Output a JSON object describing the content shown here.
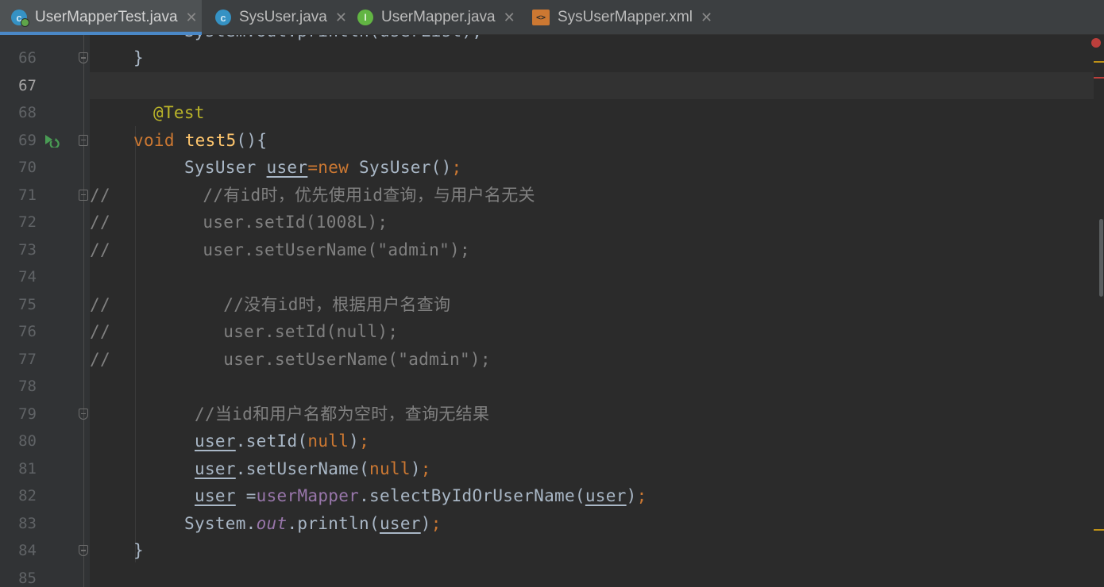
{
  "tabs": [
    {
      "label": "UserMapperTest.java",
      "icon": "test-class-icon",
      "active": true
    },
    {
      "label": "SysUser.java",
      "icon": "class-icon",
      "active": false
    },
    {
      "label": "UserMapper.java",
      "icon": "interface-icon",
      "active": false
    },
    {
      "label": "SysUserMapper.xml",
      "icon": "xml-file-icon",
      "active": false
    }
  ],
  "editor": {
    "current_line": "67",
    "partial_top_line": "System.out.println(userList);",
    "lines": [
      {
        "n": "66",
        "code": "}"
      },
      {
        "n": "67",
        "code": ""
      },
      {
        "n": "68",
        "code": "@Test"
      },
      {
        "n": "69",
        "code": "void test5(){"
      },
      {
        "n": "70",
        "code": "SysUser user=new SysUser();"
      },
      {
        "n": "71",
        "code": "//         //有id时，优先使用id查询，与用户名无关"
      },
      {
        "n": "72",
        "code": "//         user.setId(1008L);"
      },
      {
        "n": "73",
        "code": "//         user.setUserName(\"admin\");"
      },
      {
        "n": "74",
        "code": ""
      },
      {
        "n": "75",
        "code": "//           //没有id时，根据用户名查询"
      },
      {
        "n": "76",
        "code": "//           user.setId(null);"
      },
      {
        "n": "77",
        "code": "//           user.setUserName(\"admin\");"
      },
      {
        "n": "78",
        "code": ""
      },
      {
        "n": "79",
        "code": "//当id和用户名都为空时，查询无结果"
      },
      {
        "n": "80",
        "code": "user.setId(null);"
      },
      {
        "n": "81",
        "code": "user.setUserName(null);"
      },
      {
        "n": "82",
        "code": "user =userMapper.selectByIdOrUserName(user);"
      },
      {
        "n": "83",
        "code": "System.out.println(user);"
      },
      {
        "n": "84",
        "code": "}"
      },
      {
        "n": "85",
        "code": ""
      }
    ]
  },
  "colors": {
    "keyword": "#cc7832",
    "annotation": "#bbb529",
    "method_decl": "#ffc66d",
    "comment": "#808080",
    "field": "#9876aa",
    "default": "#a9b7c6",
    "background": "#2b2b2b",
    "error": "#bc3f3c",
    "warning": "#be9117"
  }
}
